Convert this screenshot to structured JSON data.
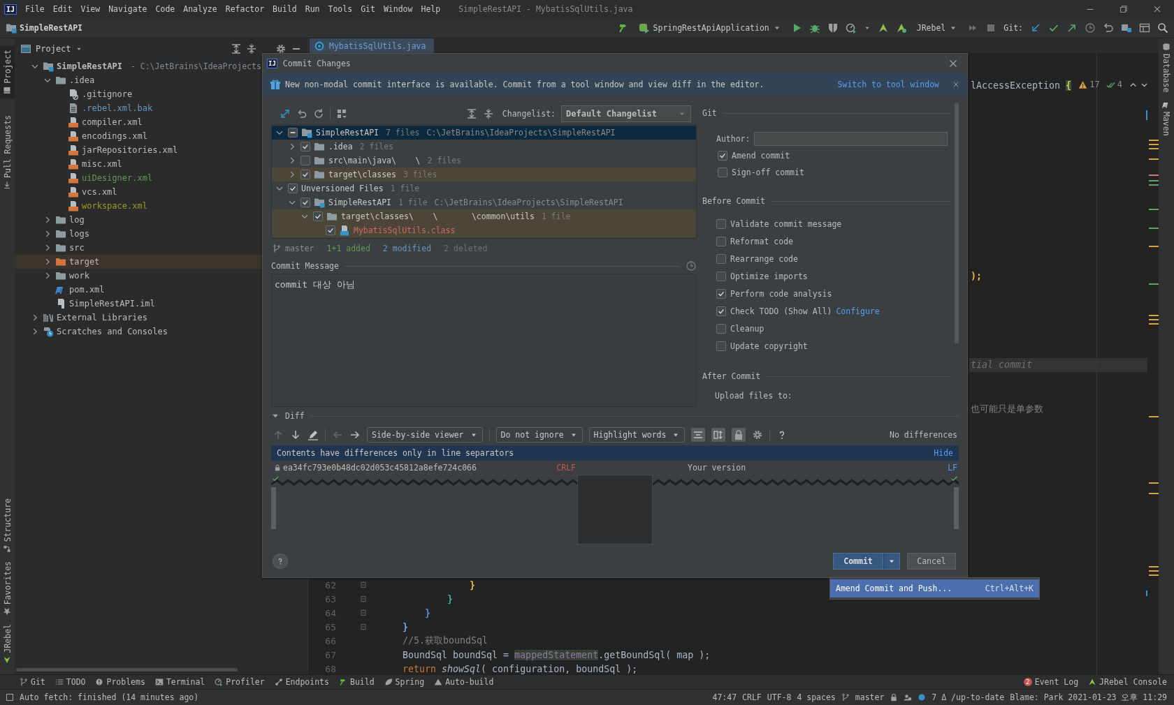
{
  "title_bar": {
    "logo": "IJ",
    "menus": [
      "File",
      "Edit",
      "View",
      "Navigate",
      "Code",
      "Analyze",
      "Refactor",
      "Build",
      "Run",
      "Tools",
      "Git",
      "Window",
      "Help"
    ],
    "title": "SimpleRestAPI - MybatisSqlUtils.java"
  },
  "nav_bar": {
    "project": "SimpleRestAPI",
    "run_config": "SpringRestApiApplication",
    "jrebel": "JRebel",
    "git_label": "Git:"
  },
  "left_stripe": {
    "top": [
      {
        "label": "Project",
        "selected": true
      },
      {
        "label": "Pull Requests",
        "selected": false
      }
    ],
    "bottom": [
      {
        "label": "Structure",
        "selected": false
      },
      {
        "label": "Favorites",
        "selected": false
      },
      {
        "label": "JRebel",
        "selected": false
      }
    ]
  },
  "right_stripe": [
    "Database",
    "Maven"
  ],
  "project_panel": {
    "title": "Project",
    "tree": [
      {
        "label": "SimpleRestAPI",
        "kind": "module",
        "path": "- C:\\JetBrains\\IdeaProjects",
        "expanded": true,
        "selected": false,
        "children": [
          {
            "label": ".idea",
            "kind": "folder",
            "expanded": true,
            "selected": false,
            "children": [
              {
                "label": ".gitignore",
                "kind": "ignore-file",
                "color": "#bbbbbb",
                "selected": false
              },
              {
                "label": ".rebel.xml.bak",
                "kind": "text-file",
                "color": "#6897bb",
                "selected": false
              },
              {
                "label": "compiler.xml",
                "kind": "xml-file",
                "color": "#bbbbbb",
                "selected": false
              },
              {
                "label": "encodings.xml",
                "kind": "xml-file",
                "color": "#bbbbbb",
                "selected": false
              },
              {
                "label": "jarRepositories.xml",
                "kind": "xml-file",
                "color": "#bbbbbb",
                "selected": false
              },
              {
                "label": "misc.xml",
                "kind": "xml-file",
                "color": "#bbbbbb",
                "selected": false
              },
              {
                "label": "uiDesigner.xml",
                "kind": "xml-file",
                "color": "#629755",
                "selected": false
              },
              {
                "label": "vcs.xml",
                "kind": "xml-file",
                "color": "#bbbbbb",
                "selected": false
              },
              {
                "label": "workspace.xml",
                "kind": "xml-file",
                "color": "#999a2a",
                "selected": false
              }
            ]
          },
          {
            "label": "log",
            "kind": "folder",
            "expanded": false,
            "selected": false
          },
          {
            "label": "logs",
            "kind": "folder",
            "expanded": false,
            "selected": false
          },
          {
            "label": "src",
            "kind": "folder",
            "expanded": false,
            "selected": false
          },
          {
            "label": "target",
            "kind": "excluded-folder",
            "expanded": false,
            "selected": true
          },
          {
            "label": "work",
            "kind": "folder",
            "expanded": false,
            "selected": false
          },
          {
            "label": "pom.xml",
            "kind": "maven-file",
            "color": "#bbbbbb",
            "selected": false
          },
          {
            "label": "SimpleRestAPI.iml",
            "kind": "iml-file",
            "color": "#bbbbbb",
            "selected": false
          }
        ]
      },
      {
        "label": "External Libraries",
        "kind": "libraries",
        "expanded": false,
        "selected": false
      },
      {
        "label": "Scratches and Consoles",
        "kind": "scratches",
        "expanded": false,
        "selected": false
      }
    ]
  },
  "editor": {
    "tab": "MybatisSqlUtils.java",
    "warnings": "17",
    "passed": "4",
    "fragments": [
      {
        "highlighted": false,
        "tokens": [
          {
            "text": "lAccessException ",
            "kind": "plain"
          },
          {
            "text": "{",
            "kind": "match"
          }
        ]
      },
      {
        "highlighted": false,
        "tokens": [
          {
            "text": ");",
            "kind": "brace",
            "color": "#e8ba36"
          }
        ]
      },
      {
        "highlighted": true,
        "tokens": [
          {
            "text": "tial commit",
            "kind": "hint"
          }
        ]
      },
      {
        "highlighted": false,
        "tokens": [
          {
            "text": "也可能只是单参数",
            "kind": "comment"
          }
        ]
      }
    ],
    "lines": [
      {
        "number": "62",
        "tokens": [
          {
            "text": "            }",
            "kind": "brace",
            "color": "#e8ba36"
          }
        ]
      },
      {
        "number": "63",
        "tokens": [
          {
            "text": "        }",
            "kind": "brace",
            "color": "#3fb1a0"
          }
        ]
      },
      {
        "number": "64",
        "tokens": [
          {
            "text": "    }",
            "kind": "brace",
            "color": "#5c8bd6"
          }
        ]
      },
      {
        "number": "65",
        "tokens": [
          {
            "text": "}",
            "kind": "brace",
            "color": "#7a9fe0"
          }
        ]
      },
      {
        "number": "66",
        "tokens": [
          {
            "text": "//5.获取boundSql",
            "kind": "comment"
          }
        ]
      },
      {
        "number": "67",
        "tokens": [
          {
            "text": "BoundSql boundSql = ",
            "kind": "plain"
          },
          {
            "text": "mappedStatement",
            "kind": "field"
          },
          {
            "text": ".getBoundSql( map );",
            "kind": "plain"
          }
        ]
      },
      {
        "number": "68",
        "tokens": [
          {
            "text": "return ",
            "kind": "keyword"
          },
          {
            "text": "showSql",
            "kind": "method"
          },
          {
            "text": "( configuration, boundSql );",
            "kind": "plain"
          }
        ]
      }
    ]
  },
  "dialog": {
    "logo": "IJ",
    "title": "Commit Changes",
    "banner": {
      "text": "New non-modal commit interface is available. Commit from a tool window and view diff in the editor.",
      "link": "Switch to tool window"
    },
    "changelist_label": "Changelist:",
    "changelist": "Default Changelist",
    "changes": [
      {
        "label": "SimpleRestAPI",
        "kind": "module",
        "count": "7 files",
        "path": "C:\\JetBrains\\IdeaProjects\\SimpleRestAPI",
        "partial": true,
        "expanded": true,
        "selected": true,
        "highlighted": false,
        "children": [
          {
            "label": ".idea",
            "kind": "folder",
            "count": "2 files",
            "checked": true,
            "partial": false,
            "expanded": false,
            "selected": false,
            "highlighted": false
          },
          {
            "label": "src\\main\\java\\    \\",
            "kind": "folder",
            "count": "2 files",
            "checked": false,
            "partial": false,
            "expanded": false,
            "selected": false,
            "highlighted": false
          },
          {
            "label": "target\\classes",
            "kind": "folder",
            "count": "3 files",
            "checked": true,
            "partial": false,
            "expanded": false,
            "selected": false,
            "highlighted": true
          }
        ]
      },
      {
        "label": "Unversioned Files",
        "kind": "group",
        "count": "1 file",
        "checked": true,
        "partial": false,
        "expanded": true,
        "selected": false,
        "highlighted": false,
        "children": [
          {
            "label": "SimpleRestAPI",
            "kind": "module",
            "count": "1 file",
            "path": "C:\\JetBrains\\IdeaProjects\\SimpleRestAPI",
            "checked": true,
            "partial": false,
            "expanded": true,
            "selected": false,
            "highlighted": false,
            "children": [
              {
                "label": "target\\classes\\    \\       \\common\\utils",
                "kind": "folder",
                "count": "1 file",
                "checked": true,
                "partial": false,
                "expanded": true,
                "selected": false,
                "highlighted": true,
                "children": [
                  {
                    "label": "MybatisSqlUtils.class",
                    "kind": "class-file",
                    "color": "#d1675a",
                    "checked": true,
                    "partial": false,
                    "selected": false,
                    "highlighted": true
                  }
                ]
              }
            ]
          }
        ]
      }
    ],
    "summary": {
      "branch": "master",
      "added": "1+1 added",
      "modified": "2 modified",
      "deleted": "2 deleted"
    },
    "message_label": "Commit Message",
    "message": "commit 대상 아님",
    "git": {
      "title": "Git",
      "author_label": "Author:",
      "checks": [
        {
          "label": "Amend commit",
          "checked": true
        },
        {
          "label": "Sign-off commit",
          "checked": false
        }
      ]
    },
    "before_commit": {
      "title": "Before Commit",
      "checks": [
        {
          "label": "Validate commit message",
          "checked": false
        },
        {
          "label": "Reformat code",
          "checked": false
        },
        {
          "label": "Rearrange code",
          "checked": false
        },
        {
          "label": "Optimize imports",
          "checked": false
        },
        {
          "label": "Perform code analysis",
          "checked": true
        },
        {
          "label": "Check TODO (Show All)",
          "checked": true,
          "link": "Configure"
        },
        {
          "label": "Cleanup",
          "checked": false
        },
        {
          "label": "Update copyright",
          "checked": false
        }
      ]
    },
    "after_commit": {
      "title": "After Commit",
      "upload_label": "Upload files to:"
    },
    "diff": {
      "title": "Diff",
      "expanded": true,
      "viewer": "Side-by-side viewer",
      "ignore": "Do not ignore",
      "highlight": "Highlight words",
      "status": "No differences",
      "notice": "Contents have differences only in line separators",
      "notice_link": "Hide",
      "left_title": "ea34fc793e0b48dc02d053c45812a8efe724c066",
      "left_separator": "CRLF",
      "right_title": "Your version",
      "right_separator": "LF"
    },
    "commit_button": "Commit",
    "cancel_button": "Cancel",
    "commit_menu": [
      {
        "label": "Amend Commit and Push...",
        "shortcut": "Ctrl+Alt+K",
        "selected": true
      }
    ]
  },
  "tool_windows": {
    "left": [
      "Git",
      "TODO",
      "Problems",
      "Terminal",
      "Profiler",
      "Endpoints",
      "Build",
      "Spring",
      "Auto-build"
    ],
    "right": [
      {
        "label": "Event Log",
        "badge": "2"
      },
      {
        "label": "JRebel Console"
      }
    ]
  },
  "status_bar": {
    "message": "Auto fetch: finished (14 minutes ago)",
    "items": [
      "47:47",
      "CRLF",
      "UTF-8",
      "4 spaces",
      "master",
      "7 Δ /up-to-date",
      "Blame: Park 2021-01-23 오후 11:29"
    ]
  }
}
